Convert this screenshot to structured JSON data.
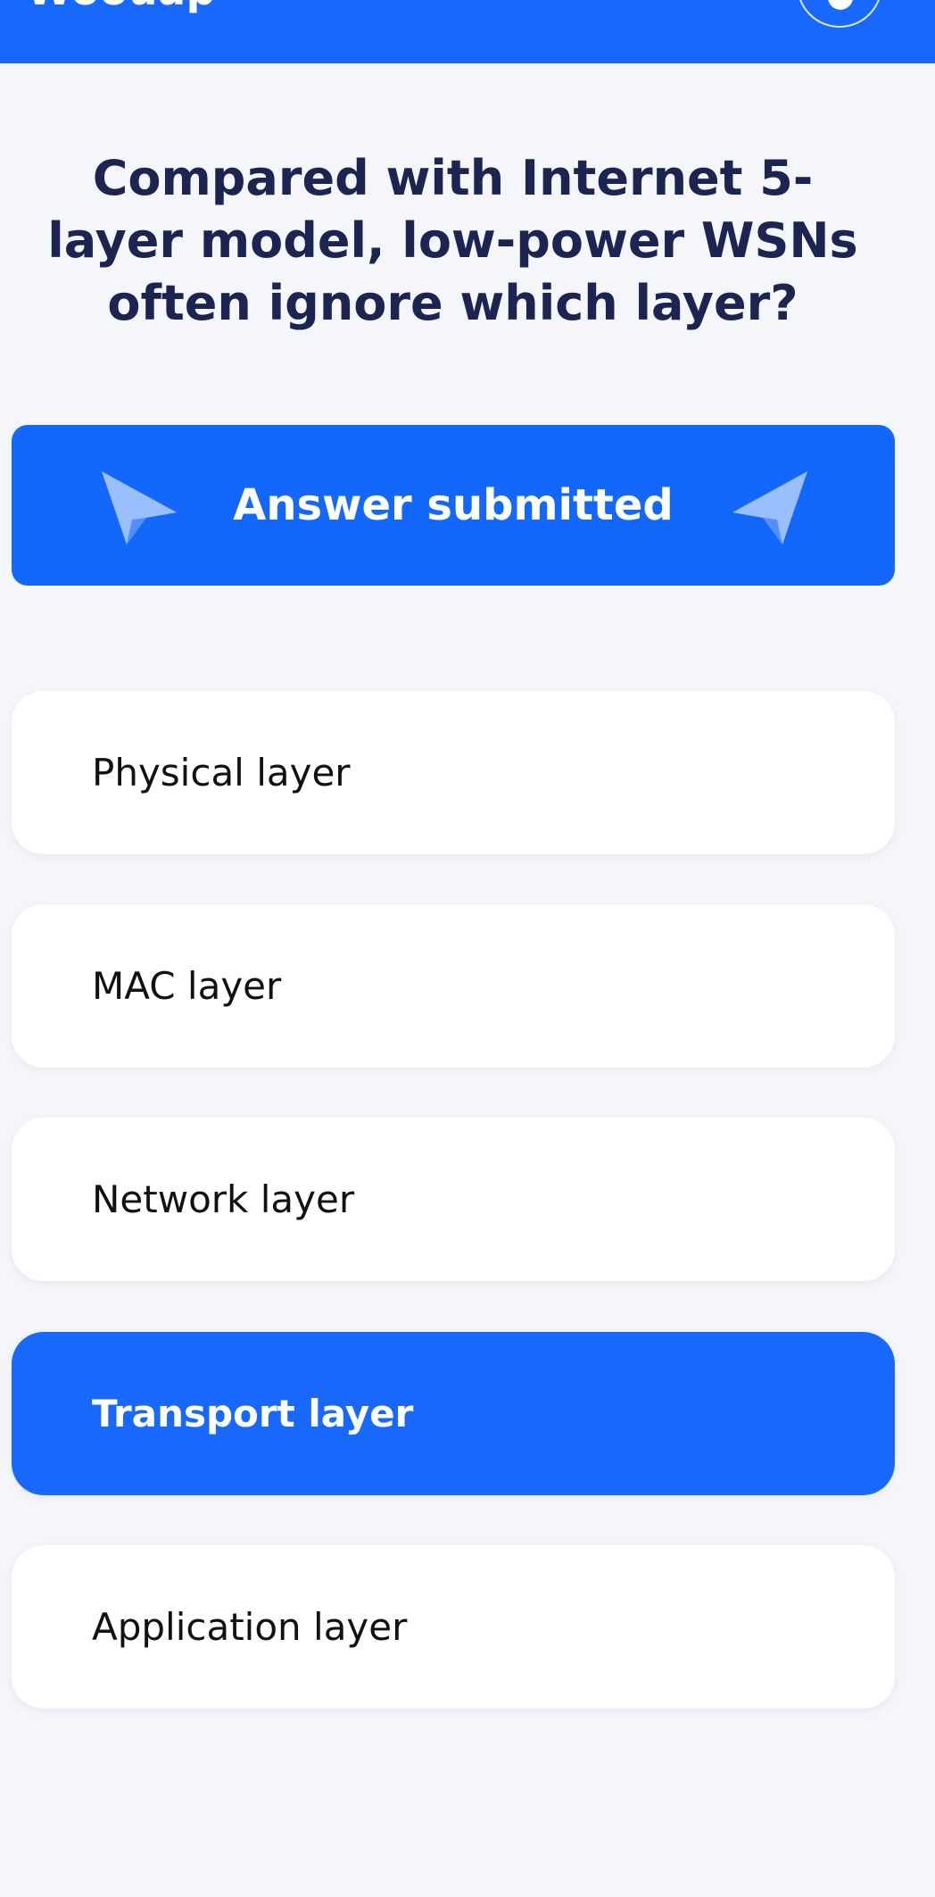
{
  "header": {
    "brand": "Woouap",
    "bg_color": "#1869fb",
    "profile_icon": "user-icon"
  },
  "question": {
    "text": "Compared with Internet 5-layer model, low-power WSNs often ignore which layer?"
  },
  "status": {
    "label": "Answer submitted",
    "bg_color": "#1368fb",
    "icon": "paper-plane-icon"
  },
  "options": [
    {
      "label": "Physical layer",
      "selected": false
    },
    {
      "label": "MAC layer",
      "selected": false
    },
    {
      "label": "Network layer",
      "selected": false
    },
    {
      "label": "Transport layer",
      "selected": true
    },
    {
      "label": "Application layer",
      "selected": false
    }
  ],
  "colors": {
    "page_bg": "#f4f6fa",
    "question_text": "#1c2451",
    "selected_option": "#1869fb",
    "option_bg": "#ffffff",
    "plane_icon": "#9bbefc"
  }
}
